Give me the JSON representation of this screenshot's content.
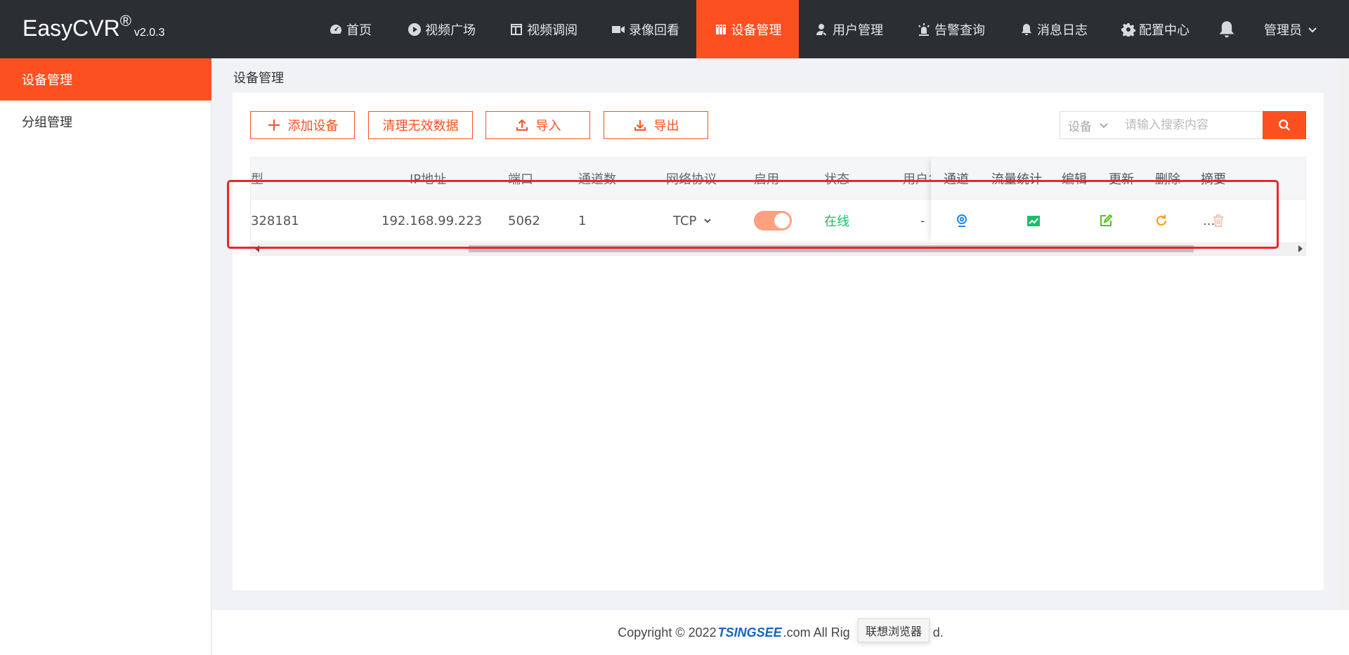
{
  "app": {
    "logo_name": "EasyCVR",
    "logo_reg": "®",
    "version": "v2.0.3"
  },
  "nav": {
    "items": [
      {
        "label": "首页",
        "icon": "dashboard-icon"
      },
      {
        "label": "视频广场",
        "icon": "play-circle-icon"
      },
      {
        "label": "视频调阅",
        "icon": "layout-icon"
      },
      {
        "label": "录像回看",
        "icon": "video-camera-icon"
      },
      {
        "label": "设备管理",
        "icon": "device-icon",
        "active": true
      },
      {
        "label": "用户管理",
        "icon": "user-icon"
      },
      {
        "label": "告警查询",
        "icon": "alarm-icon"
      },
      {
        "label": "消息日志",
        "icon": "bell-icon"
      },
      {
        "label": "配置中心",
        "icon": "gear-icon"
      }
    ],
    "user": "管理员"
  },
  "sidebar": {
    "items": [
      {
        "label": "设备管理",
        "active": true
      },
      {
        "label": "分组管理"
      }
    ]
  },
  "breadcrumb": "设备管理",
  "toolbar": {
    "add_label": "添加设备",
    "clear_label": "清理无效数据",
    "import_label": "导入",
    "export_label": "导出"
  },
  "search": {
    "field": "设备",
    "placeholder": "请输入搜索内容"
  },
  "table": {
    "headers": {
      "type": "型",
      "ip": "IP地址",
      "port": "端口",
      "channels": "通道数",
      "protocol": "网络协议",
      "enabled": "启用",
      "status": "状态",
      "user": "用户名",
      "channel": "通道",
      "traffic": "流量统计",
      "edit": "编辑",
      "update": "更新",
      "delete": "删除",
      "summary": "摘要"
    },
    "row": {
      "type": "328181",
      "ip": "192.168.99.223",
      "port": "5062",
      "channels": "1",
      "protocol": "TCP",
      "enabled": true,
      "status": "在线",
      "user": "-",
      "summary": "..."
    }
  },
  "colors": {
    "accent": "#fc5020",
    "nav_bg": "#2b2f33",
    "online": "#19be6b",
    "channel_icon": "#1e88e5",
    "traffic_icon": "#19be6b",
    "edit_icon": "#52c41a",
    "update_icon": "#ff9900",
    "delete_icon": "#fbc4b4",
    "highlight": "#e8262b"
  },
  "footer": {
    "before": "Copyright © 2022 ",
    "brand": "TSINGSEE",
    "after": ".com All Rig",
    "tail": "d."
  },
  "tooltip": "联想浏览器"
}
